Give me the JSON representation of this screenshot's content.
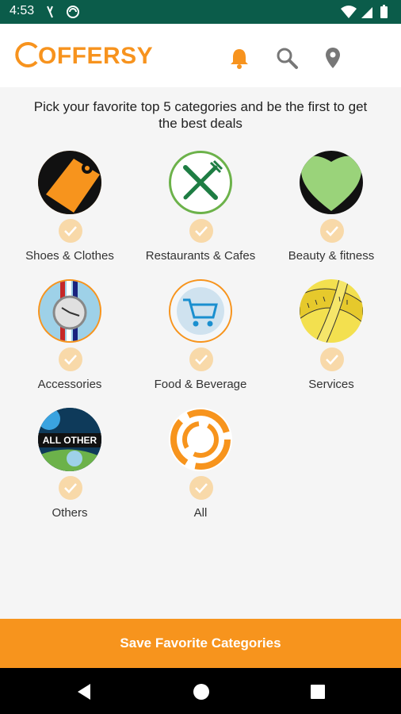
{
  "status_bar": {
    "time": "4:53"
  },
  "app": {
    "logo_text": "OFFERSY",
    "brand_color": "#f7931e",
    "icons": [
      "bell-icon",
      "search-icon",
      "location-pin-icon"
    ]
  },
  "intro": {
    "text": "Pick your favorite top 5 categories and be the first to get the best deals"
  },
  "categories": [
    {
      "label": "Shoes & Clothes",
      "icon": "price-tag-icon",
      "selected": false
    },
    {
      "label": "Restaurants & Cafes",
      "icon": "fork-knife-icon",
      "selected": false
    },
    {
      "label": "Beauty & fitness",
      "icon": "heart-icon",
      "selected": false
    },
    {
      "label": "Accessories",
      "icon": "watch-icon",
      "selected": false
    },
    {
      "label": "Food & Beverage",
      "icon": "shopping-cart-icon",
      "selected": false
    },
    {
      "label": "Services",
      "icon": "measuring-tape-icon",
      "selected": false
    },
    {
      "label": "Others",
      "icon": "all-other-icon",
      "selected": false,
      "badge_text": "ALL OTHER"
    },
    {
      "label": "All",
      "icon": "offersy-logo-icon",
      "selected": false
    }
  ],
  "save_button": {
    "label": "Save Favorite Categories"
  },
  "nav_bar": {
    "buttons": [
      "back-icon",
      "home-icon",
      "recents-icon"
    ]
  }
}
